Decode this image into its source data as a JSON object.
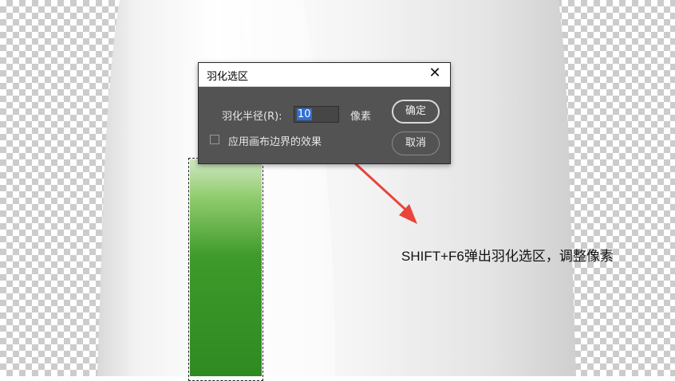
{
  "dialog": {
    "title": "羽化选区",
    "close_symbol": "✕",
    "radius_label": "羽化半径(R):",
    "radius_value": "10",
    "unit": "像素",
    "apply_canvas_label": "应用画布边界的效果",
    "apply_canvas_checked": false,
    "ok_label": "确定",
    "cancel_label": "取消"
  },
  "annotation": {
    "text": "SHIFT+F6弹出羽化选区，调整像素"
  },
  "colors": {
    "dialog_bg": "#535353",
    "selection_text": "#2f6fd6",
    "arrow": "#e8453c",
    "label_green": "#3e9a2a"
  }
}
